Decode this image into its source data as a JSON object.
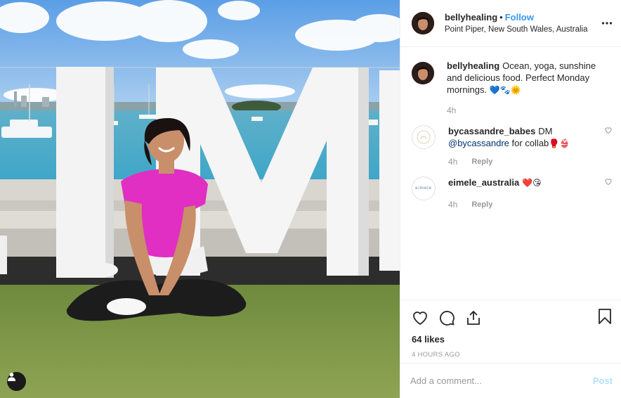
{
  "post": {
    "username": "bellyhealing",
    "separator": "•",
    "follow_label": "Follow",
    "location": "Point Piper, New South Wales, Australia"
  },
  "caption": {
    "username": "bellyhealing",
    "text": "Ocean, yoga, sunshine and delicious food. Perfect Monday mornings.",
    "emojis": "💙🐾🌞",
    "time": "4h"
  },
  "comments": [
    {
      "username": "bycassandre_babes",
      "text_before": "DM",
      "mention": "@bycassandre",
      "text_after": "for collab",
      "emojis": "🥊👙",
      "time": "4h",
      "reply_label": "Reply"
    },
    {
      "username": "eimele_australia",
      "text_before": "",
      "mention": "",
      "text_after": "",
      "emojis": "❤️😘",
      "time": "4h",
      "reply_label": "Reply",
      "avatar_text": "eimele"
    }
  ],
  "likes_label": "64 likes",
  "timestamp": "4 HOURS AGO",
  "add_comment": {
    "placeholder": "Add a comment...",
    "post_label": "Post"
  },
  "icons": {
    "more": "more-options-icon",
    "like": "heart-icon",
    "comment": "comment-bubble-icon",
    "share": "share-icon",
    "save": "bookmark-icon",
    "tag": "user-tag-icon"
  },
  "colors": {
    "accent": "#3897f0",
    "mention": "#003569",
    "muted": "#999999",
    "post_disabled": "#b2dffc",
    "shirt": "#e02fc2"
  }
}
